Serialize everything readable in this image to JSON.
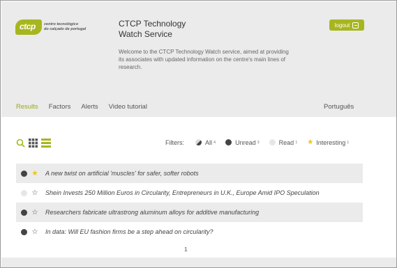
{
  "logo": {
    "mark": "ctcp",
    "line1": "centro tecnológico",
    "line2": "do calçado de portugal"
  },
  "header": {
    "title_line1": "CTCP Technology",
    "title_line2": "Watch Service",
    "welcome": "Welcome to the CTCP Technology Watch service, aimed at providing its associates with updated information on the centre's main lines of research.",
    "logout_label": "logout"
  },
  "nav": {
    "items": [
      "Results",
      "Factors",
      "Alerts",
      "Video tutorial"
    ],
    "active": "Results",
    "language": "Português"
  },
  "filters": {
    "label": "Filters:",
    "all": {
      "label": "All",
      "count": "4"
    },
    "unread": {
      "label": "Unread",
      "count": "3"
    },
    "read": {
      "label": "Read",
      "count": "1"
    },
    "interesting": {
      "label": "Interesting",
      "count": "1"
    }
  },
  "results": [
    {
      "title": "A new twist on artificial 'muscles' for safer, softer robots",
      "read": false,
      "interesting": true
    },
    {
      "title": "Shein Invests 250 Million Euros in Circularity, Entrepreneurs in U.K., Europe Amid IPO Speculation",
      "read": true,
      "interesting": false
    },
    {
      "title": "Researchers fabricate ultrastrong aluminum alloys for additive manufacturing",
      "read": false,
      "interesting": false
    },
    {
      "title": "In data: Will EU fashion firms be a step ahead on circularity?",
      "read": false,
      "interesting": false
    }
  ],
  "pagination": {
    "current": "1"
  },
  "colors": {
    "accent": "#a7b61f",
    "star": "#f0c410",
    "header_bg": "#ebebeb"
  },
  "icons": [
    "search-icon",
    "grid-view-icon",
    "list-view-icon",
    "logout-icon",
    "star-icon"
  ]
}
